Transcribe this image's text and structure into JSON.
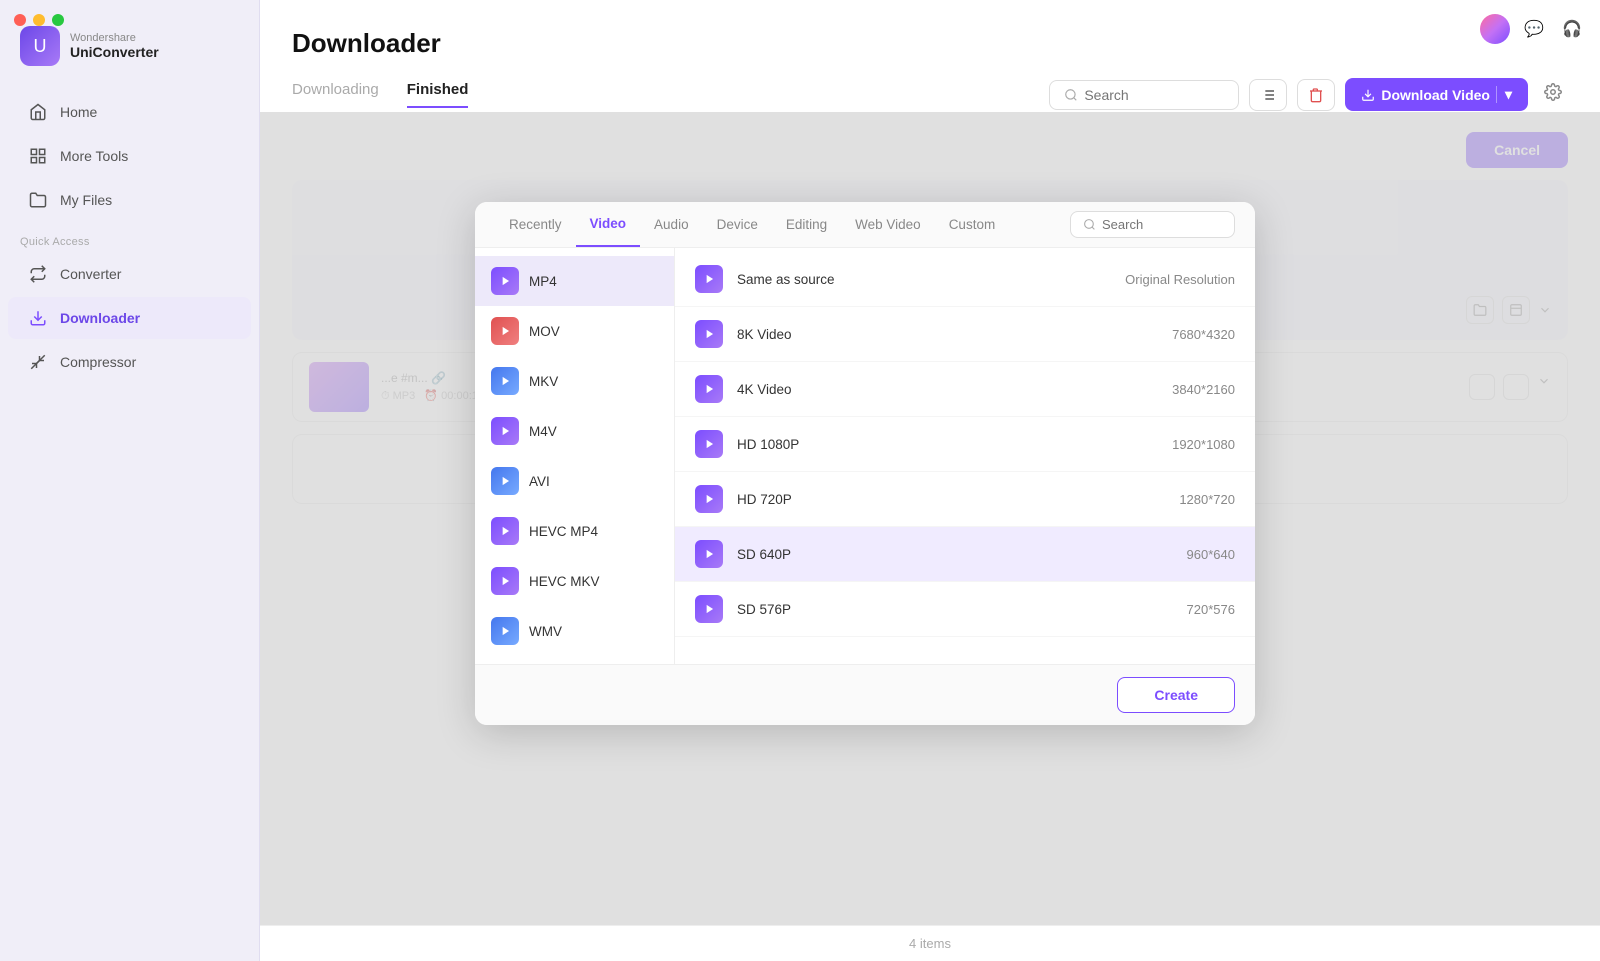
{
  "app": {
    "brand": "Wondershare",
    "name": "UniConverter"
  },
  "window_controls": {
    "close": "close",
    "minimize": "minimize",
    "maximize": "maximize"
  },
  "topbar_icons": {
    "avatar_alt": "user-avatar",
    "chat_icon": "chat",
    "headset_icon": "headset"
  },
  "sidebar": {
    "items": [
      {
        "id": "home",
        "label": "Home",
        "icon": "home"
      },
      {
        "id": "more-tools",
        "label": "More Tools",
        "icon": "grid"
      },
      {
        "id": "my-files",
        "label": "My Files",
        "icon": "files"
      }
    ],
    "quick_access_label": "Quick Access",
    "quick_access_items": [
      {
        "id": "converter",
        "label": "Converter",
        "icon": "converter"
      },
      {
        "id": "downloader",
        "label": "Downloader",
        "icon": "downloader",
        "active": true
      },
      {
        "id": "compressor",
        "label": "Compressor",
        "icon": "compressor"
      }
    ]
  },
  "page": {
    "title": "Downloader",
    "tabs": [
      {
        "id": "downloading",
        "label": "Downloading",
        "active": false
      },
      {
        "id": "finished",
        "label": "Finished",
        "active": true
      }
    ]
  },
  "header_actions": {
    "search_placeholder": "Search",
    "list_view_btn": "list-view",
    "delete_btn": "delete",
    "download_video_label": "Download Video",
    "dropdown_btn": "dropdown",
    "settings_btn": "settings"
  },
  "modal": {
    "tabs": [
      {
        "id": "recently",
        "label": "Recently",
        "active": false
      },
      {
        "id": "video",
        "label": "Video",
        "active": true
      },
      {
        "id": "audio",
        "label": "Audio",
        "active": false
      },
      {
        "id": "device",
        "label": "Device",
        "active": false
      },
      {
        "id": "editing",
        "label": "Editing",
        "active": false
      },
      {
        "id": "web-video",
        "label": "Web Video",
        "active": false
      },
      {
        "id": "custom",
        "label": "Custom",
        "active": false
      }
    ],
    "search_placeholder": "Search",
    "formats": [
      {
        "id": "mp4",
        "label": "MP4",
        "type": "mp4",
        "active": true
      },
      {
        "id": "mov",
        "label": "MOV",
        "type": "mov"
      },
      {
        "id": "mkv",
        "label": "MKV",
        "type": "mkv"
      },
      {
        "id": "m4v",
        "label": "M4V",
        "type": "m4v"
      },
      {
        "id": "avi",
        "label": "AVI",
        "type": "avi"
      },
      {
        "id": "hevc-mp4",
        "label": "HEVC MP4",
        "type": "hevc"
      },
      {
        "id": "hevc-mkv",
        "label": "HEVC MKV",
        "type": "hevc"
      },
      {
        "id": "wmv",
        "label": "WMV",
        "type": "wmv"
      }
    ],
    "qualities": [
      {
        "id": "same-as-source",
        "label": "Same as source",
        "resolution": "Original Resolution",
        "selected": false
      },
      {
        "id": "8k-video",
        "label": "8K Video",
        "resolution": "7680*4320",
        "selected": false
      },
      {
        "id": "4k-video",
        "label": "4K Video",
        "resolution": "3840*2160",
        "selected": false
      },
      {
        "id": "hd-1080p",
        "label": "HD 1080P",
        "resolution": "1920*1080",
        "selected": false
      },
      {
        "id": "hd-720p",
        "label": "HD 720P",
        "resolution": "1280*720",
        "selected": false
      },
      {
        "id": "sd-640p",
        "label": "SD 640P",
        "resolution": "960*640",
        "selected": true
      },
      {
        "id": "sd-576p",
        "label": "SD 576P",
        "resolution": "720*576",
        "selected": false
      }
    ],
    "create_btn": "Create",
    "cancel_btn": "Cancel"
  },
  "footer": {
    "items_count": "4 items"
  }
}
